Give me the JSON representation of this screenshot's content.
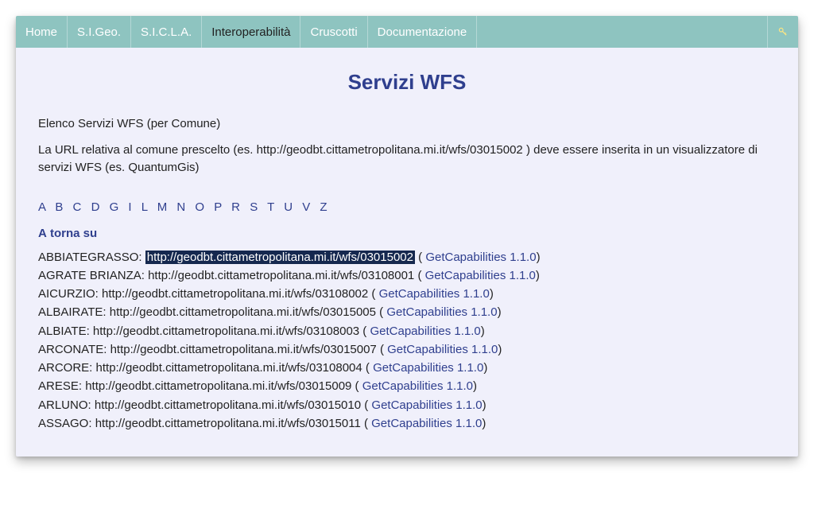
{
  "navbar": {
    "items": [
      "Home",
      "S.I.Geo.",
      "S.I.C.L.A.",
      "Interoperabilità",
      "Cruscotti",
      "Documentazione"
    ],
    "activeIndex": 3
  },
  "header": {
    "title": "Servizi WFS"
  },
  "intro": {
    "subtitle": "Elenco Servizi WFS (per Comune)",
    "description": "La URL relativa al comune prescelto (es. http://geodbt.cittametropolitana.mi.it/wfs/03015002 ) deve essere inserita in un visualizzatore di servizi WFS (es. QuantumGis)"
  },
  "alphabet": [
    "A",
    "B",
    "C",
    "D",
    "G",
    "I",
    "L",
    "M",
    "N",
    "O",
    "P",
    "R",
    "S",
    "T",
    "U",
    "V",
    "Z"
  ],
  "letterAnchor": {
    "letter": "A",
    "back": "torna su"
  },
  "rowsMeta": {
    "capLabel": "GetCapabilities 1.1.0"
  },
  "rows": [
    {
      "name": "ABBIATEGRASSO",
      "url": "http://geodbt.cittametropolitana.mi.it/wfs/03015002",
      "highlight": true
    },
    {
      "name": "AGRATE BRIANZA",
      "url": "http://geodbt.cittametropolitana.mi.it/wfs/03108001"
    },
    {
      "name": "AICURZIO",
      "url": "http://geodbt.cittametropolitana.mi.it/wfs/03108002"
    },
    {
      "name": "ALBAIRATE",
      "url": "http://geodbt.cittametropolitana.mi.it/wfs/03015005"
    },
    {
      "name": "ALBIATE",
      "url": "http://geodbt.cittametropolitana.mi.it/wfs/03108003"
    },
    {
      "name": "ARCONATE",
      "url": "http://geodbt.cittametropolitana.mi.it/wfs/03015007"
    },
    {
      "name": "ARCORE",
      "url": "http://geodbt.cittametropolitana.mi.it/wfs/03108004"
    },
    {
      "name": "ARESE",
      "url": "http://geodbt.cittametropolitana.mi.it/wfs/03015009"
    },
    {
      "name": "ARLUNO",
      "url": "http://geodbt.cittametropolitana.mi.it/wfs/03015010"
    },
    {
      "name": "ASSAGO",
      "url": "http://geodbt.cittametropolitana.mi.it/wfs/03015011"
    }
  ]
}
